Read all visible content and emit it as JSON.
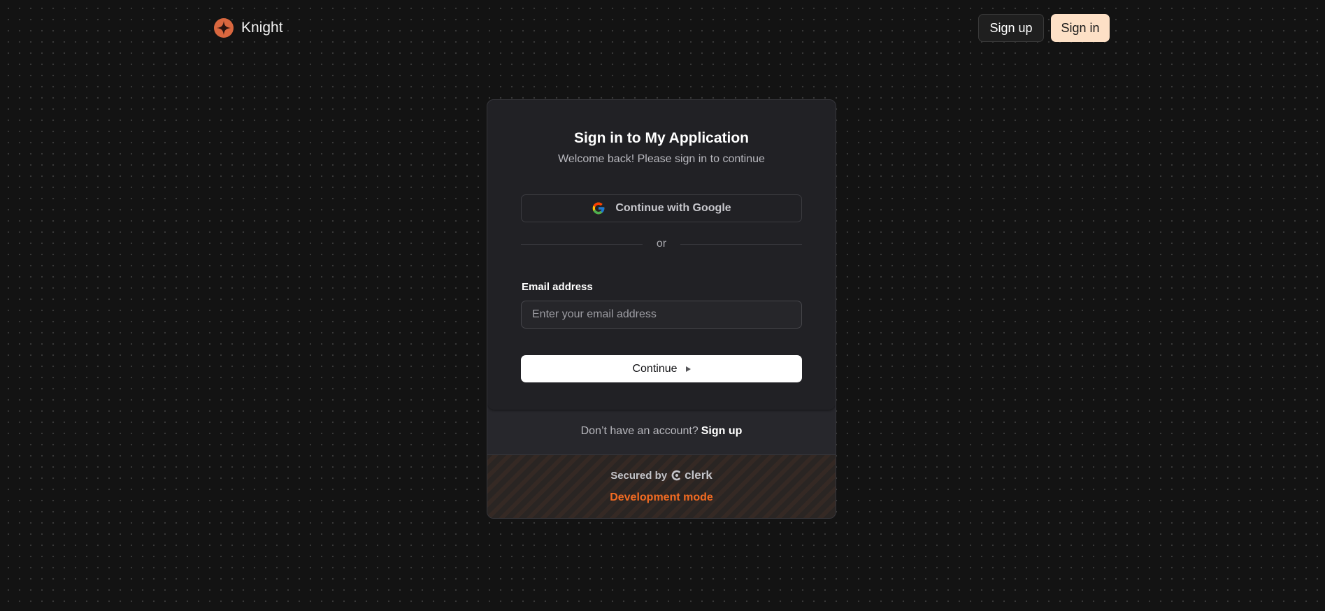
{
  "header": {
    "brand_name": "Knight",
    "signup_label": "Sign up",
    "signin_label": "Sign in"
  },
  "card": {
    "title": "Sign in to My Application",
    "subtitle": "Welcome back! Please sign in to continue",
    "google_label": "Continue with Google",
    "divider_text": "or",
    "email_label": "Email address",
    "email_placeholder": "Enter your email address",
    "email_value": "",
    "continue_label": "Continue"
  },
  "footer": {
    "prompt": "Don’t have an account?",
    "signup_link": "Sign up",
    "secured_by": "Secured by",
    "clerk_word": "clerk",
    "dev_mode": "Development mode"
  },
  "icons": {
    "brand": "knight-star-logo-icon",
    "google": "google-icon",
    "continue": "caret-right-icon",
    "clerk": "clerk-logo-icon"
  },
  "colors": {
    "background": "#131313",
    "card": "#212125",
    "signin_button": "#fde0c6",
    "brand_accent": "#d9673f",
    "dev_mode": "#f36b22"
  }
}
